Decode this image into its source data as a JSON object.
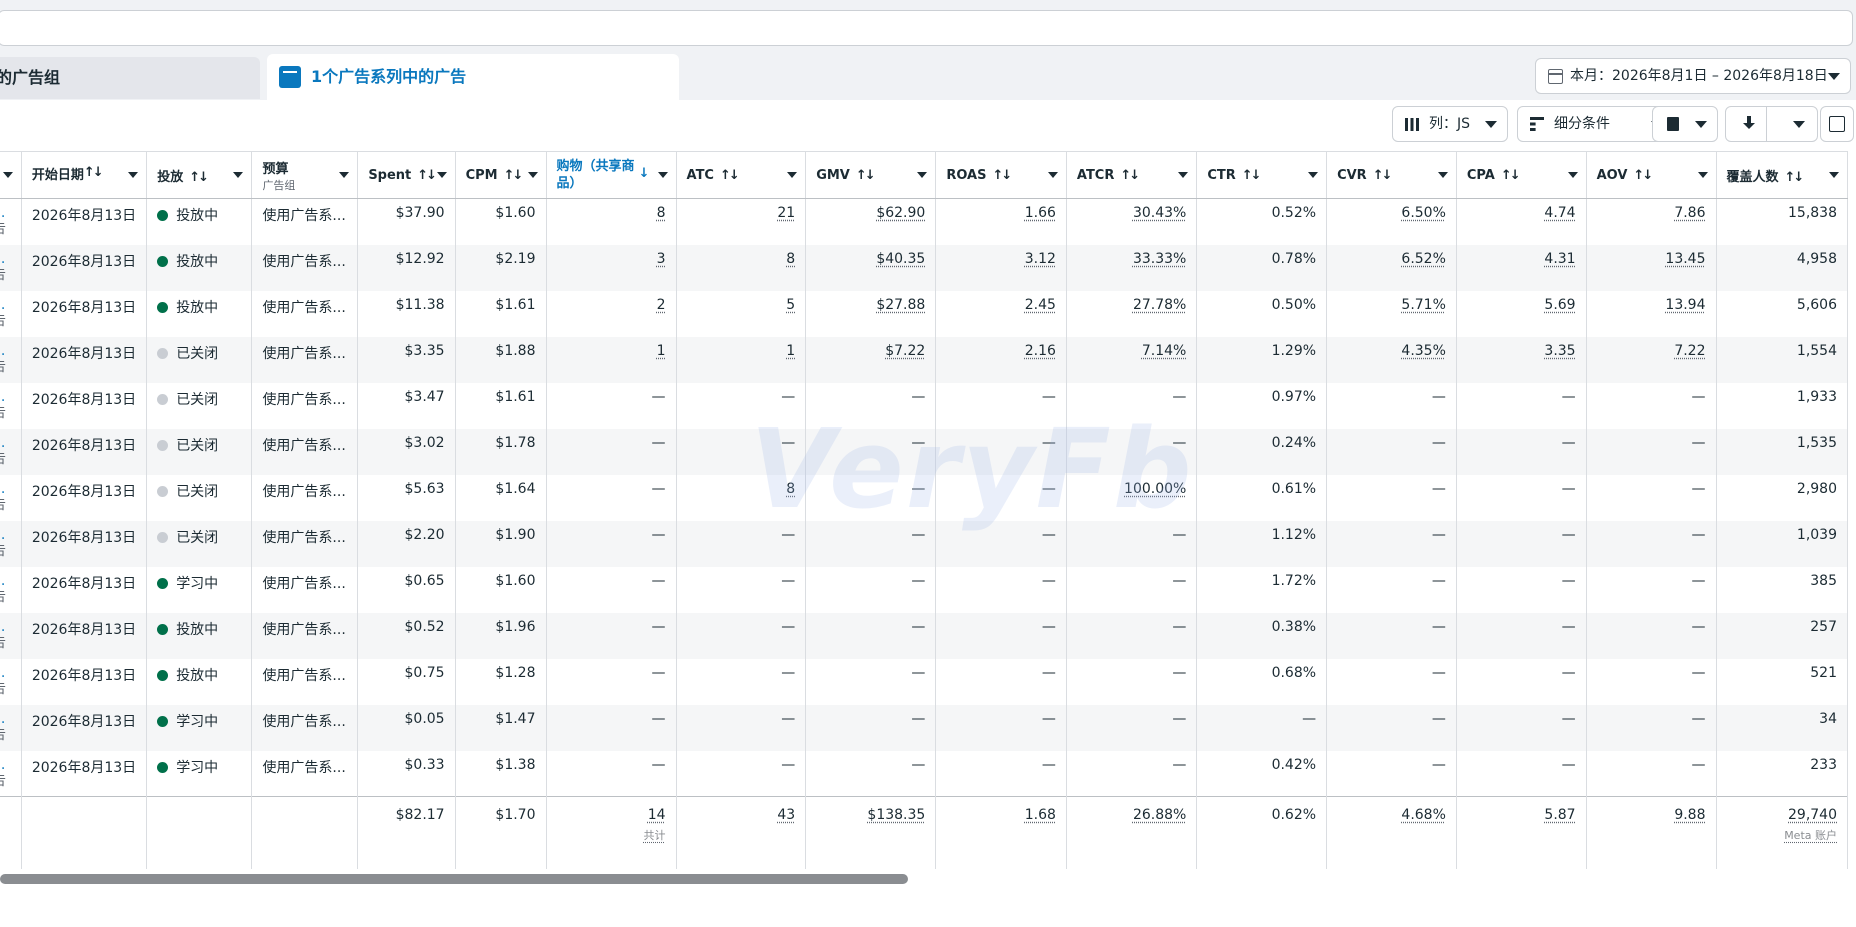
{
  "tabs": {
    "adsets_label": "的广告组",
    "ads_label": "1个广告系列中的广告"
  },
  "date_range": {
    "label": "本月：2026年8月1日 – 2026年8月18日"
  },
  "toolbar": {
    "columns_label": "列：JS",
    "breakdown_label": "细分条件"
  },
  "columns": {
    "start_date": "开始日期",
    "delivery": "投放",
    "budget": "预算",
    "budget_sub": "广告组",
    "spent": "Spent",
    "cpm": "CPM",
    "purchases": "购物（共享商品）",
    "atc": "ATC",
    "gmv": "GMV",
    "roas": "ROAS",
    "atcr": "ATCR",
    "ctr": "CTR",
    "cvr": "CVR",
    "cpa": "CPA",
    "aov": "AOV",
    "reach": "覆盖人数"
  },
  "rows": [
    {
      "start": "2026年8月13日",
      "status": "投放中",
      "on": true,
      "budget": "使用广告系...",
      "spent": "$37.90",
      "cpm": "$1.60",
      "purch": "8",
      "atc": "21",
      "gmv": "$62.90",
      "roas": "1.66",
      "atcr": "30.43%",
      "ctr": "0.52%",
      "cvr": "6.50%",
      "cpa": "4.74",
      "aov": "7.86",
      "reach": "15,838"
    },
    {
      "start": "2026年8月13日",
      "status": "投放中",
      "on": true,
      "budget": "使用广告系...",
      "spent": "$12.92",
      "cpm": "$2.19",
      "purch": "3",
      "atc": "8",
      "gmv": "$40.35",
      "roas": "3.12",
      "atcr": "33.33%",
      "ctr": "0.78%",
      "cvr": "6.52%",
      "cpa": "4.31",
      "aov": "13.45",
      "reach": "4,958"
    },
    {
      "start": "2026年8月13日",
      "status": "投放中",
      "on": true,
      "budget": "使用广告系...",
      "spent": "$11.38",
      "cpm": "$1.61",
      "purch": "2",
      "atc": "5",
      "gmv": "$27.88",
      "roas": "2.45",
      "atcr": "27.78%",
      "ctr": "0.50%",
      "cvr": "5.71%",
      "cpa": "5.69",
      "aov": "13.94",
      "reach": "5,606"
    },
    {
      "start": "2026年8月13日",
      "status": "已关闭",
      "on": false,
      "budget": "使用广告系...",
      "spent": "$3.35",
      "cpm": "$1.88",
      "purch": "1",
      "atc": "1",
      "gmv": "$7.22",
      "roas": "2.16",
      "atcr": "7.14%",
      "ctr": "1.29%",
      "cvr": "4.35%",
      "cpa": "3.35",
      "aov": "7.22",
      "reach": "1,554"
    },
    {
      "start": "2026年8月13日",
      "status": "已关闭",
      "on": false,
      "budget": "使用广告系...",
      "spent": "$3.47",
      "cpm": "$1.61",
      "purch": "—",
      "atc": "—",
      "gmv": "—",
      "roas": "—",
      "atcr": "—",
      "ctr": "0.97%",
      "cvr": "—",
      "cpa": "—",
      "aov": "—",
      "reach": "1,933"
    },
    {
      "start": "2026年8月13日",
      "status": "已关闭",
      "on": false,
      "budget": "使用广告系...",
      "spent": "$3.02",
      "cpm": "$1.78",
      "purch": "—",
      "atc": "—",
      "gmv": "—",
      "roas": "—",
      "atcr": "—",
      "ctr": "0.24%",
      "cvr": "—",
      "cpa": "—",
      "aov": "—",
      "reach": "1,535"
    },
    {
      "start": "2026年8月13日",
      "status": "已关闭",
      "on": false,
      "budget": "使用广告系...",
      "spent": "$5.63",
      "cpm": "$1.64",
      "purch": "—",
      "atc": "8",
      "gmv": "—",
      "roas": "—",
      "atcr": "100.00%",
      "ctr": "0.61%",
      "cvr": "—",
      "cpa": "—",
      "aov": "—",
      "reach": "2,980"
    },
    {
      "start": "2026年8月13日",
      "status": "已关闭",
      "on": false,
      "budget": "使用广告系...",
      "spent": "$2.20",
      "cpm": "$1.90",
      "purch": "—",
      "atc": "—",
      "gmv": "—",
      "roas": "—",
      "atcr": "—",
      "ctr": "1.12%",
      "cvr": "—",
      "cpa": "—",
      "aov": "—",
      "reach": "1,039"
    },
    {
      "start": "2026年8月13日",
      "status": "学习中",
      "on": true,
      "budget": "使用广告系...",
      "spent": "$0.65",
      "cpm": "$1.60",
      "purch": "—",
      "atc": "—",
      "gmv": "—",
      "roas": "—",
      "atcr": "—",
      "ctr": "1.72%",
      "cvr": "—",
      "cpa": "—",
      "aov": "—",
      "reach": "385"
    },
    {
      "start": "2026年8月13日",
      "status": "投放中",
      "on": true,
      "budget": "使用广告系...",
      "spent": "$0.52",
      "cpm": "$1.96",
      "purch": "—",
      "atc": "—",
      "gmv": "—",
      "roas": "—",
      "atcr": "—",
      "ctr": "0.38%",
      "cvr": "—",
      "cpa": "—",
      "aov": "—",
      "reach": "257"
    },
    {
      "start": "2026年8月13日",
      "status": "投放中",
      "on": true,
      "budget": "使用广告系...",
      "spent": "$0.75",
      "cpm": "$1.28",
      "purch": "—",
      "atc": "—",
      "gmv": "—",
      "roas": "—",
      "atcr": "—",
      "ctr": "0.68%",
      "cvr": "—",
      "cpa": "—",
      "aov": "—",
      "reach": "521"
    },
    {
      "start": "2026年8月13日",
      "status": "学习中",
      "on": true,
      "budget": "使用广告系...",
      "spent": "$0.05",
      "cpm": "$1.47",
      "purch": "—",
      "atc": "—",
      "gmv": "—",
      "roas": "—",
      "atcr": "—",
      "ctr": "—",
      "cvr": "—",
      "cpa": "—",
      "aov": "—",
      "reach": "34"
    },
    {
      "start": "2026年8月13日",
      "status": "学习中",
      "on": true,
      "budget": "使用广告系...",
      "spent": "$0.33",
      "cpm": "$1.38",
      "purch": "—",
      "atc": "—",
      "gmv": "—",
      "roas": "—",
      "atcr": "—",
      "ctr": "0.42%",
      "cvr": "—",
      "cpa": "—",
      "aov": "—",
      "reach": "233"
    }
  ],
  "name_cell": {
    "dots": "...",
    "sub": "告"
  },
  "totals": {
    "spent": "$82.17",
    "cpm": "$1.70",
    "purch": "14",
    "purch_sub": "共计",
    "atc": "43",
    "gmv": "$138.35",
    "roas": "1.68",
    "atcr": "26.88%",
    "ctr": "0.62%",
    "cvr": "4.68%",
    "cpa": "5.87",
    "aov": "9.88",
    "reach": "29,740",
    "reach_sub": "Meta 账户"
  },
  "watermark": "VeryFb"
}
